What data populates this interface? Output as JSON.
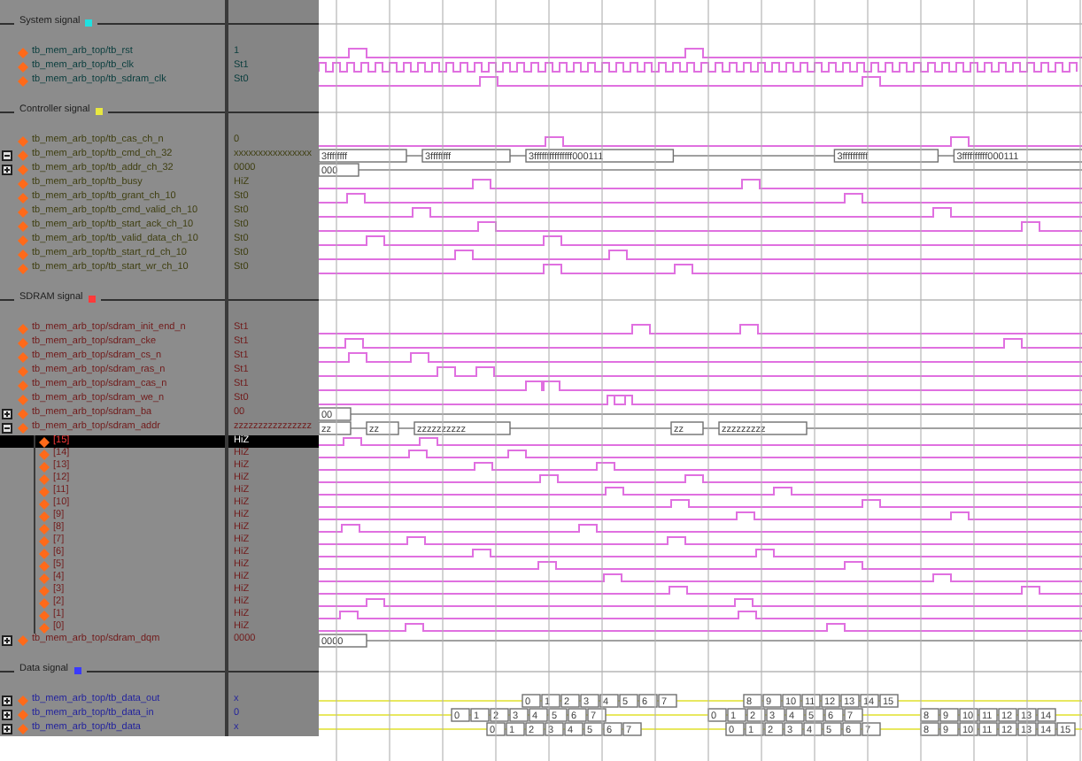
{
  "groups": [
    {
      "title": "System signal",
      "color": "#20e0e0",
      "signals": [
        {
          "name": "tb_mem_arb_top/tb_rst",
          "value": "1",
          "kind": "bit"
        },
        {
          "name": "tb_mem_arb_top/tb_clk",
          "value": "St1",
          "kind": "clock"
        },
        {
          "name": "tb_mem_arb_top/tb_sdram_clk",
          "value": "St0",
          "kind": "bit"
        }
      ]
    },
    {
      "title": "Controller signal",
      "color": "#e8e840",
      "signals": [
        {
          "name": "tb_mem_arb_top/tb_cas_ch_n",
          "value": "0",
          "kind": "bit"
        },
        {
          "name": "tb_mem_arb_top/tb_cmd_ch_32",
          "value": "xxxxxxxxxxxxxxxx",
          "kind": "bus",
          "expanded": true,
          "segments": [
            "3ffffffff",
            "3ffffffff",
            "3fffffffffffffff000111",
            "3ffffffffff",
            "3ffffffffff000111"
          ]
        },
        {
          "name": "tb_mem_arb_top/tb_addr_ch_32",
          "value": "0000",
          "kind": "bus",
          "expanded": false,
          "segments": [
            "000"
          ]
        },
        {
          "name": "tb_mem_arb_top/tb_busy",
          "value": "HiZ",
          "kind": "bit"
        },
        {
          "name": "tb_mem_arb_top/tb_grant_ch_10",
          "value": "St0",
          "kind": "bit"
        },
        {
          "name": "tb_mem_arb_top/tb_cmd_valid_ch_10",
          "value": "St0",
          "kind": "bit"
        },
        {
          "name": "tb_mem_arb_top/tb_start_ack_ch_10",
          "value": "St0",
          "kind": "bit"
        },
        {
          "name": "tb_mem_arb_top/tb_valid_data_ch_10",
          "value": "St0",
          "kind": "bit"
        },
        {
          "name": "tb_mem_arb_top/tb_start_rd_ch_10",
          "value": "St0",
          "kind": "bit"
        },
        {
          "name": "tb_mem_arb_top/tb_start_wr_ch_10",
          "value": "St0",
          "kind": "bit"
        }
      ]
    },
    {
      "title": "SDRAM signal",
      "color": "#ff3a3a",
      "signals": [
        {
          "name": "tb_mem_arb_top/sdram_init_end_n",
          "value": "St1",
          "kind": "bit"
        },
        {
          "name": "tb_mem_arb_top/sdram_cke",
          "value": "St1",
          "kind": "bit"
        },
        {
          "name": "tb_mem_arb_top/sdram_cs_n",
          "value": "St1",
          "kind": "bit"
        },
        {
          "name": "tb_mem_arb_top/sdram_ras_n",
          "value": "St1",
          "kind": "bit"
        },
        {
          "name": "tb_mem_arb_top/sdram_cas_n",
          "value": "St1",
          "kind": "bit"
        },
        {
          "name": "tb_mem_arb_top/sdram_we_n",
          "value": "St0",
          "kind": "bit"
        },
        {
          "name": "tb_mem_arb_top/sdram_ba",
          "value": "00",
          "kind": "bus",
          "expanded": false,
          "segments": [
            "00"
          ]
        },
        {
          "name": "tb_mem_arb_top/sdram_addr",
          "value": "zzzzzzzzzzzzzzzz",
          "kind": "bus",
          "expanded": true,
          "segments": [
            "zz",
            "zz",
            "zzzzzzzzzz",
            "zz",
            "zzzzzzzzz"
          ],
          "children": [
            {
              "name": "[15]",
              "value": "HiZ",
              "kind": "bit",
              "selected": true
            },
            {
              "name": "[14]",
              "value": "HiZ",
              "kind": "bit",
              "selected": false
            },
            {
              "name": "[13]",
              "value": "HiZ",
              "kind": "bit",
              "selected": false
            },
            {
              "name": "[12]",
              "value": "HiZ",
              "kind": "bit",
              "selected": false
            },
            {
              "name": "[11]",
              "value": "HiZ",
              "kind": "bit",
              "selected": false
            },
            {
              "name": "[10]",
              "value": "HiZ",
              "kind": "bit",
              "selected": false
            },
            {
              "name": "[9]",
              "value": "HiZ",
              "kind": "bit",
              "selected": false
            },
            {
              "name": "[8]",
              "value": "HiZ",
              "kind": "bit",
              "selected": false
            },
            {
              "name": "[7]",
              "value": "HiZ",
              "kind": "bit",
              "selected": false
            },
            {
              "name": "[6]",
              "value": "HiZ",
              "kind": "bit",
              "selected": false
            },
            {
              "name": "[5]",
              "value": "HiZ",
              "kind": "bit",
              "selected": false
            },
            {
              "name": "[4]",
              "value": "HiZ",
              "kind": "bit",
              "selected": false
            },
            {
              "name": "[3]",
              "value": "HiZ",
              "kind": "bit",
              "selected": false
            },
            {
              "name": "[2]",
              "value": "HiZ",
              "kind": "bit",
              "selected": false
            },
            {
              "name": "[1]",
              "value": "HiZ",
              "kind": "bit",
              "selected": false
            },
            {
              "name": "[0]",
              "value": "HiZ",
              "kind": "bit",
              "selected": false
            }
          ]
        },
        {
          "name": "tb_mem_arb_top/sdram_dqm",
          "value": "0000",
          "kind": "bus",
          "expanded": false,
          "segments": [
            "0000"
          ]
        }
      ]
    },
    {
      "title": "Data signal",
      "color": "#3a3aff",
      "signals": [
        {
          "name": "tb_mem_arb_top/tb_data_out",
          "value": "x",
          "kind": "bus",
          "expanded": false,
          "segments": [
            "0",
            "1",
            "2",
            "3",
            "4",
            "5",
            "6",
            "7",
            "8",
            "9",
            "10",
            "11",
            "12",
            "13",
            "14",
            "15"
          ]
        },
        {
          "name": "tb_mem_arb_top/tb_data_in",
          "value": "0",
          "kind": "bus",
          "expanded": false,
          "segments": [
            "0",
            "1",
            "2",
            "3",
            "4",
            "5",
            "6",
            "7",
            "0",
            "1",
            "2",
            "3",
            "4",
            "5",
            "6",
            "7",
            "8",
            "9",
            "10",
            "11",
            "12",
            "13",
            "14"
          ]
        },
        {
          "name": "tb_mem_arb_top/tb_data",
          "value": "x",
          "kind": "bus",
          "expanded": false,
          "segments": [
            "0",
            "1",
            "2",
            "3",
            "4",
            "5",
            "6",
            "7",
            "0",
            "1",
            "2",
            "3",
            "4",
            "5",
            "6",
            "7",
            "8",
            "9",
            "10",
            "11",
            "12",
            "13",
            "14",
            "15"
          ]
        }
      ]
    }
  ]
}
